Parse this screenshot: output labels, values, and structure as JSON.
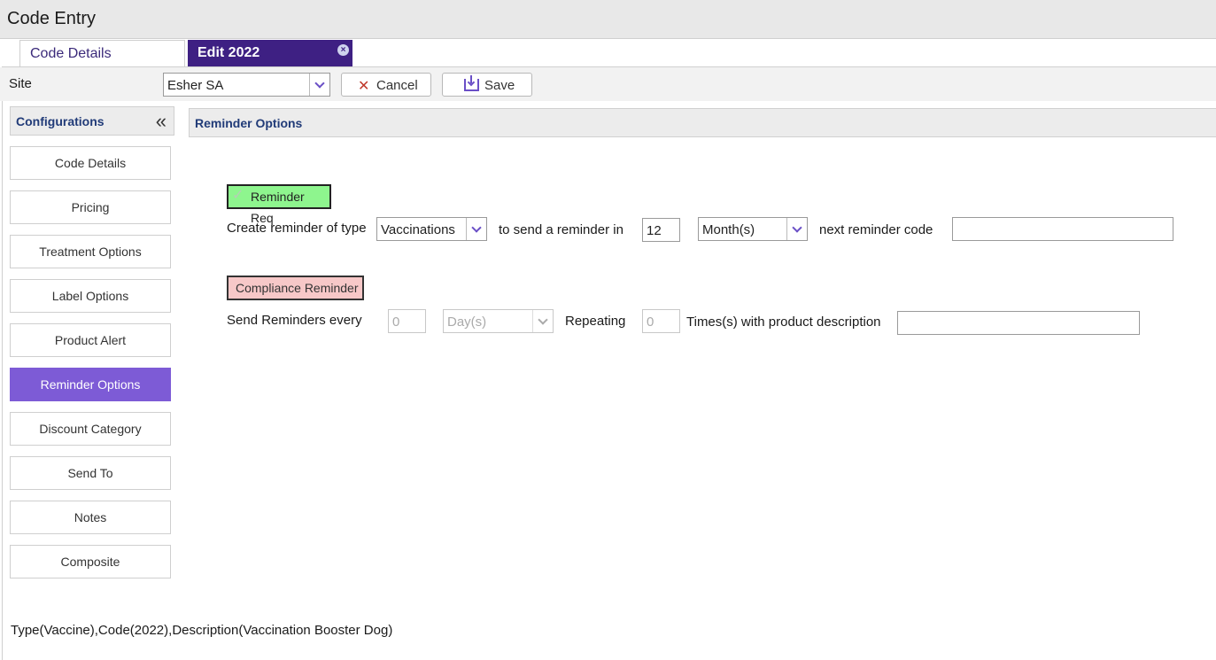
{
  "window": {
    "title": "Code Entry"
  },
  "tabs": [
    {
      "label": "Code Details"
    },
    {
      "label": "Edit 2022",
      "close_icon": "×"
    }
  ],
  "toolbar": {
    "site_label": "Site",
    "site_value": "Esher SA",
    "cancel_label": "Cancel",
    "save_label": "Save"
  },
  "sidebar": {
    "title": "Configurations",
    "collapse_icon": "«",
    "items": [
      {
        "label": "Code Details"
      },
      {
        "label": "Pricing"
      },
      {
        "label": "Treatment Options"
      },
      {
        "label": "Label Options"
      },
      {
        "label": "Product Alert"
      },
      {
        "label": "Reminder Options",
        "active": true
      },
      {
        "label": "Discount Category"
      },
      {
        "label": "Send To"
      },
      {
        "label": "Notes"
      },
      {
        "label": "Composite"
      }
    ]
  },
  "section": {
    "title": "Reminder Options"
  },
  "reminder": {
    "toggle_label": "Reminder Req",
    "toggle_checked": true,
    "create_label": "Create reminder of type",
    "type_value": "Vaccinations",
    "send_in_label": "to send a reminder in",
    "interval_value": "12",
    "unit_value": "Month(s)",
    "next_code_label": "next reminder code",
    "next_code_value": ""
  },
  "compliance": {
    "toggle_label": "Compliance Reminder",
    "toggle_checked": false,
    "every_label": "Send Reminders every",
    "every_value": "0",
    "unit_value": "Day(s)",
    "repeating_label": "Repeating",
    "repeat_value": "0",
    "times_label": "Times(s) with product description",
    "description_value": ""
  },
  "footer": {
    "text": "Type(Vaccine),Code(2022),Description(Vaccination Booster Dog)"
  },
  "colors": {
    "accent": "#7d5bd6",
    "tab_active": "#3e2083",
    "toggle_on": "#8ef58e",
    "toggle_off": "#f7c8c8",
    "heading": "#213b78"
  }
}
